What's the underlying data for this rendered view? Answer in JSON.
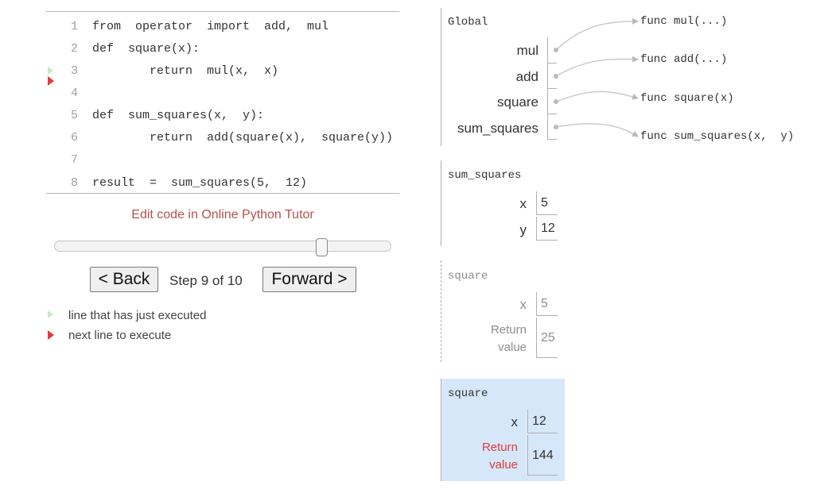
{
  "code": {
    "lines": [
      {
        "num": "1",
        "text": "from  operator  import  add,  mul"
      },
      {
        "num": "2",
        "text": "def  square(x):"
      },
      {
        "num": "3",
        "text": "        return  mul(x,  x)"
      },
      {
        "num": "4",
        "text": ""
      },
      {
        "num": "5",
        "text": "def  sum_squares(x,  y):"
      },
      {
        "num": "6",
        "text": "        return  add(square(x),  square(y))"
      },
      {
        "num": "7",
        "text": ""
      },
      {
        "num": "8",
        "text": "result  =  sum_squares(5,  12)"
      }
    ],
    "edit_link": "Edit code in Online Python Tutor"
  },
  "controls": {
    "back_label": "< Back",
    "step_text": "Step 9 of 10",
    "forward_label": "Forward >",
    "step_current": 9,
    "step_total": 10
  },
  "legend": {
    "just_executed": "line that has just executed",
    "next_line": "next line to execute"
  },
  "frames": {
    "global": {
      "title": "Global",
      "vars": [
        "mul",
        "add",
        "square",
        "sum_squares"
      ]
    },
    "sum_squares": {
      "title": "sum_squares",
      "x_name": "x",
      "x_val": "5",
      "y_name": "y",
      "y_val": "12"
    },
    "square1": {
      "title": "square",
      "x_name": "x",
      "x_val": "5",
      "ret_line1": "Return",
      "ret_line2": "value",
      "ret_val": "25"
    },
    "square2": {
      "title": "square",
      "x_name": "x",
      "x_val": "12",
      "ret_line1": "Return",
      "ret_line2": "value",
      "ret_val": "144"
    }
  },
  "objects": [
    "func mul(...)",
    "func add(...)",
    "func square(x)",
    "func sum_squares(x,  y)"
  ],
  "colors": {
    "active_frame_bg": "#d6e7fa",
    "edit_link": "#b4524a",
    "next_line_arrow": "#e33b3b",
    "just_executed_arrow": "#c6e9c4"
  }
}
